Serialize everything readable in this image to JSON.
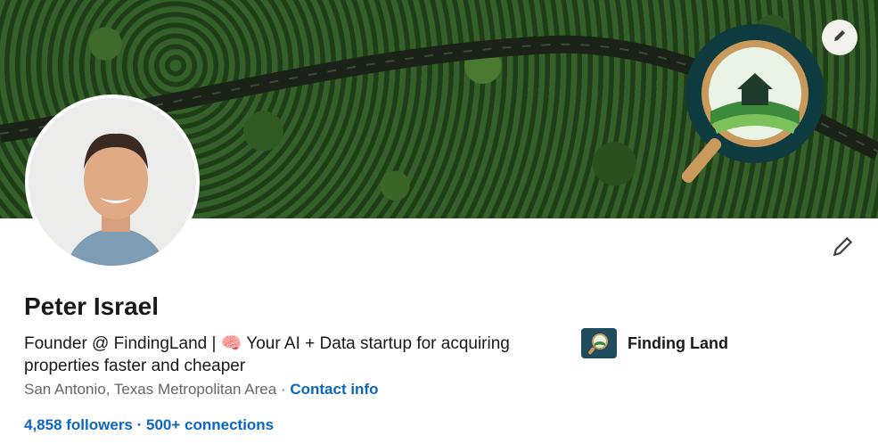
{
  "profile": {
    "name": "Peter Israel",
    "headline_part1": "Founder @ FindingLand | ",
    "headline_emoji": "🧠",
    "headline_part2": " Your AI + Data startup for acquiring properties faster and cheaper",
    "location": "San Antonio, Texas Metropolitan Area",
    "separator": " · ",
    "contact_label": "Contact info",
    "followers": "4,858 followers",
    "stats_separator": " · ",
    "connections": "500+ connections"
  },
  "company": {
    "name": "Finding Land"
  },
  "icons": {
    "banner_edit": "pencil-icon",
    "profile_edit": "pencil-icon"
  },
  "colors": {
    "link": "#0a66c2",
    "text": "#191919",
    "muted": "#666666"
  }
}
